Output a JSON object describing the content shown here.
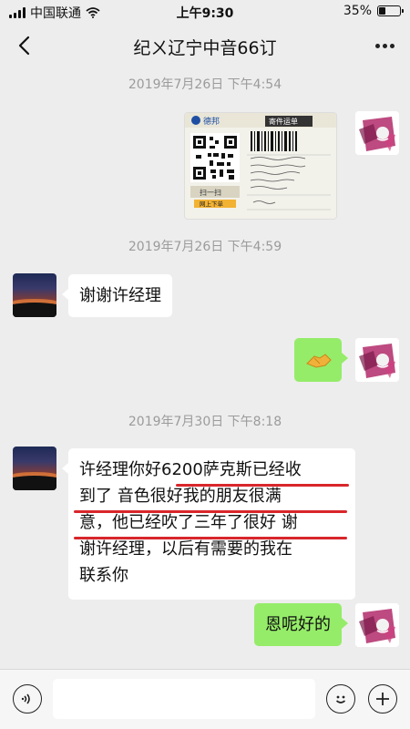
{
  "status": {
    "carrier": "中国联通",
    "time": "上午9:30",
    "battery": "35%",
    "battery_level": 0.35
  },
  "nav": {
    "title": "纪ㄨ辽宁中音66订"
  },
  "messages": {
    "ts1": "2019年7月26日 下午4:54",
    "ts2": "2019年7月26日 下午4:59",
    "thanks": "谢谢许经理",
    "ts3": "2019年7月30日 下午8:18",
    "review_lines": [
      "许经理你好6200萨克斯已经收",
      "到了 音色很好我的朋友很满",
      "意，他已经吹了三年了很好  谢",
      "谢许经理，以后有需要的我在",
      "联系你"
    ],
    "reply": "恩呢好的"
  },
  "waybill": {
    "brand": "德邦",
    "label": "寄件运单",
    "scan_label": "扫一扫",
    "scan_sub": "网上下单"
  },
  "colors": {
    "bubble_green": "#95ec69",
    "underline_red": "#d8262b",
    "background": "#ededed"
  },
  "icons": [
    "back-icon",
    "more-icon",
    "voice-icon",
    "emoji-icon",
    "plus-icon",
    "thumbs-up-icon"
  ]
}
